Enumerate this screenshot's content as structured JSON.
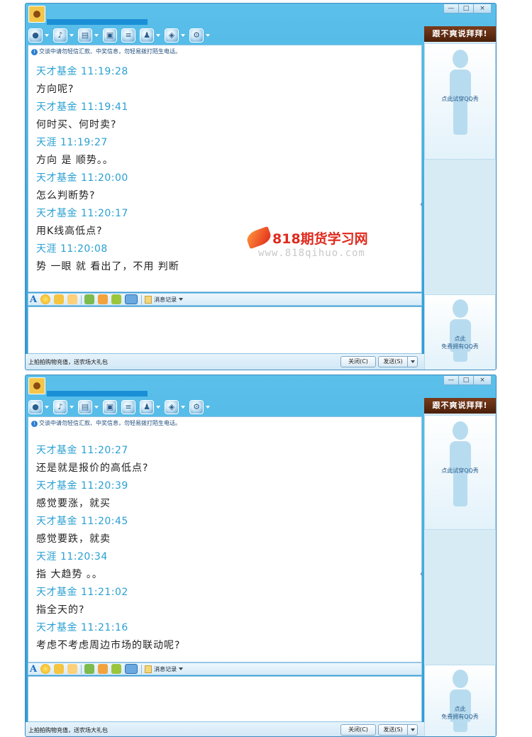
{
  "window_controls": {
    "minimize": "—",
    "maximize": "□",
    "close": "×"
  },
  "toolbar_icons": [
    "video-call-icon",
    "voice-call-icon",
    "send-file-icon",
    "remote-assist-icon",
    "app-icon",
    "group-icon",
    "share-screen-icon",
    "settings-icon"
  ],
  "notice": "交谈中请勿轻信汇款、中奖信息，勿轻易拨打陌生电话。",
  "watermark": {
    "brand": "818期货学习网",
    "url": "www.818qihuo.com"
  },
  "format_bar": {
    "font_glyph": "A",
    "history_label": "消息记录"
  },
  "bottom": {
    "promo": "上拍拍购物充值，送农场大礼包",
    "close_button": "关闭(C)",
    "send_button": "发送(S)"
  },
  "right_panel": {
    "banner": "跟不爽说拜拜!",
    "show_top_text": "点此试穿QQ秀",
    "show_bottom_text_1": "点此",
    "show_bottom_text_2": "免费拥有QQ秀",
    "collapse_arrow": "‹"
  },
  "windows": [
    {
      "messages": [
        {
          "header": "天才基金 11:19:28",
          "text": "方向呢?"
        },
        {
          "header": "天才基金 11:19:41",
          "text": "何时买、何时卖?"
        },
        {
          "header": "天涯 11:19:27",
          "text": "方向 是 顺势。。"
        },
        {
          "header": "天才基金 11:20:00",
          "text": "怎么判断势?"
        },
        {
          "header": "天才基金 11:20:17",
          "text": "用K线高低点?"
        },
        {
          "header": "天涯 11:20:08",
          "text": "势 一眼 就 看出了，不用  判断"
        }
      ]
    },
    {
      "messages": [
        {
          "header": "天才基金 11:20:27",
          "text": "还是就是报价的高低点?"
        },
        {
          "header": "天才基金 11:20:39",
          "text": "感觉要涨，就买"
        },
        {
          "header": "天才基金 11:20:45",
          "text": "感觉要跌，就卖"
        },
        {
          "header": "天涯 11:20:34",
          "text": "指 大趋势 。。"
        },
        {
          "header": "天才基金 11:21:02",
          "text": "指全天的?"
        },
        {
          "header": "天才基金 11:21:16",
          "text": "考虑不考虑周边市场的联动呢?"
        }
      ]
    }
  ]
}
